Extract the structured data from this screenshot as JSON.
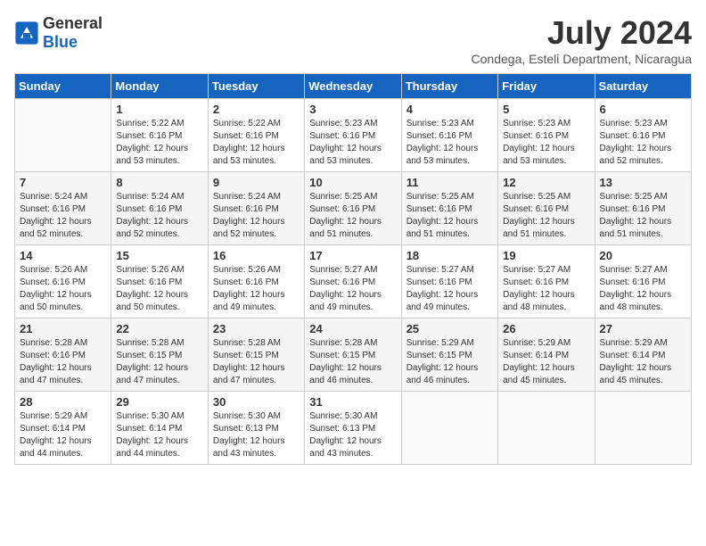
{
  "header": {
    "logo_general": "General",
    "logo_blue": "Blue",
    "month_year": "July 2024",
    "location": "Condega, Esteli Department, Nicaragua"
  },
  "weekdays": [
    "Sunday",
    "Monday",
    "Tuesday",
    "Wednesday",
    "Thursday",
    "Friday",
    "Saturday"
  ],
  "weeks": [
    [
      {
        "day": "",
        "info": ""
      },
      {
        "day": "1",
        "info": "Sunrise: 5:22 AM\nSunset: 6:16 PM\nDaylight: 12 hours\nand 53 minutes."
      },
      {
        "day": "2",
        "info": "Sunrise: 5:22 AM\nSunset: 6:16 PM\nDaylight: 12 hours\nand 53 minutes."
      },
      {
        "day": "3",
        "info": "Sunrise: 5:23 AM\nSunset: 6:16 PM\nDaylight: 12 hours\nand 53 minutes."
      },
      {
        "day": "4",
        "info": "Sunrise: 5:23 AM\nSunset: 6:16 PM\nDaylight: 12 hours\nand 53 minutes."
      },
      {
        "day": "5",
        "info": "Sunrise: 5:23 AM\nSunset: 6:16 PM\nDaylight: 12 hours\nand 53 minutes."
      },
      {
        "day": "6",
        "info": "Sunrise: 5:23 AM\nSunset: 6:16 PM\nDaylight: 12 hours\nand 52 minutes."
      }
    ],
    [
      {
        "day": "7",
        "info": "Sunrise: 5:24 AM\nSunset: 6:16 PM\nDaylight: 12 hours\nand 52 minutes."
      },
      {
        "day": "8",
        "info": "Sunrise: 5:24 AM\nSunset: 6:16 PM\nDaylight: 12 hours\nand 52 minutes."
      },
      {
        "day": "9",
        "info": "Sunrise: 5:24 AM\nSunset: 6:16 PM\nDaylight: 12 hours\nand 52 minutes."
      },
      {
        "day": "10",
        "info": "Sunrise: 5:25 AM\nSunset: 6:16 PM\nDaylight: 12 hours\nand 51 minutes."
      },
      {
        "day": "11",
        "info": "Sunrise: 5:25 AM\nSunset: 6:16 PM\nDaylight: 12 hours\nand 51 minutes."
      },
      {
        "day": "12",
        "info": "Sunrise: 5:25 AM\nSunset: 6:16 PM\nDaylight: 12 hours\nand 51 minutes."
      },
      {
        "day": "13",
        "info": "Sunrise: 5:25 AM\nSunset: 6:16 PM\nDaylight: 12 hours\nand 51 minutes."
      }
    ],
    [
      {
        "day": "14",
        "info": "Sunrise: 5:26 AM\nSunset: 6:16 PM\nDaylight: 12 hours\nand 50 minutes."
      },
      {
        "day": "15",
        "info": "Sunrise: 5:26 AM\nSunset: 6:16 PM\nDaylight: 12 hours\nand 50 minutes."
      },
      {
        "day": "16",
        "info": "Sunrise: 5:26 AM\nSunset: 6:16 PM\nDaylight: 12 hours\nand 49 minutes."
      },
      {
        "day": "17",
        "info": "Sunrise: 5:27 AM\nSunset: 6:16 PM\nDaylight: 12 hours\nand 49 minutes."
      },
      {
        "day": "18",
        "info": "Sunrise: 5:27 AM\nSunset: 6:16 PM\nDaylight: 12 hours\nand 49 minutes."
      },
      {
        "day": "19",
        "info": "Sunrise: 5:27 AM\nSunset: 6:16 PM\nDaylight: 12 hours\nand 48 minutes."
      },
      {
        "day": "20",
        "info": "Sunrise: 5:27 AM\nSunset: 6:16 PM\nDaylight: 12 hours\nand 48 minutes."
      }
    ],
    [
      {
        "day": "21",
        "info": "Sunrise: 5:28 AM\nSunset: 6:16 PM\nDaylight: 12 hours\nand 47 minutes."
      },
      {
        "day": "22",
        "info": "Sunrise: 5:28 AM\nSunset: 6:15 PM\nDaylight: 12 hours\nand 47 minutes."
      },
      {
        "day": "23",
        "info": "Sunrise: 5:28 AM\nSunset: 6:15 PM\nDaylight: 12 hours\nand 47 minutes."
      },
      {
        "day": "24",
        "info": "Sunrise: 5:28 AM\nSunset: 6:15 PM\nDaylight: 12 hours\nand 46 minutes."
      },
      {
        "day": "25",
        "info": "Sunrise: 5:29 AM\nSunset: 6:15 PM\nDaylight: 12 hours\nand 46 minutes."
      },
      {
        "day": "26",
        "info": "Sunrise: 5:29 AM\nSunset: 6:14 PM\nDaylight: 12 hours\nand 45 minutes."
      },
      {
        "day": "27",
        "info": "Sunrise: 5:29 AM\nSunset: 6:14 PM\nDaylight: 12 hours\nand 45 minutes."
      }
    ],
    [
      {
        "day": "28",
        "info": "Sunrise: 5:29 AM\nSunset: 6:14 PM\nDaylight: 12 hours\nand 44 minutes."
      },
      {
        "day": "29",
        "info": "Sunrise: 5:30 AM\nSunset: 6:14 PM\nDaylight: 12 hours\nand 44 minutes."
      },
      {
        "day": "30",
        "info": "Sunrise: 5:30 AM\nSunset: 6:13 PM\nDaylight: 12 hours\nand 43 minutes."
      },
      {
        "day": "31",
        "info": "Sunrise: 5:30 AM\nSunset: 6:13 PM\nDaylight: 12 hours\nand 43 minutes."
      },
      {
        "day": "",
        "info": ""
      },
      {
        "day": "",
        "info": ""
      },
      {
        "day": "",
        "info": ""
      }
    ]
  ]
}
